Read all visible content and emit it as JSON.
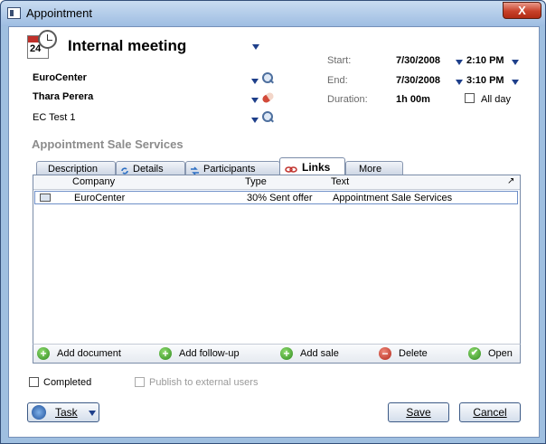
{
  "window": {
    "title": "Appointment",
    "close_glyph": "X"
  },
  "header": {
    "calendar_day": "24",
    "title": "Internal meeting",
    "company": "EuroCenter",
    "contact": "Thara Perera",
    "project": "EC Test 1"
  },
  "time": {
    "start_label": "Start:",
    "start_date": "7/30/2008",
    "start_time": "2:10 PM",
    "end_label": "End:",
    "end_date": "7/30/2008",
    "end_time": "3:10 PM",
    "duration_label": "Duration:",
    "duration_value": "1h 00m",
    "allday_label": "All day"
  },
  "section": {
    "title": "Appointment Sale Services"
  },
  "tabs": [
    {
      "label": "Description",
      "icon": "none",
      "active": false
    },
    {
      "label": "Details",
      "icon": "refresh-icon",
      "active": false
    },
    {
      "label": "Participants",
      "icon": "participants-icon",
      "active": false
    },
    {
      "label": "Links",
      "icon": "link-icon",
      "active": true
    },
    {
      "label": "More",
      "icon": "none",
      "active": false
    }
  ],
  "grid": {
    "columns": [
      "Company",
      "Type",
      "Text"
    ],
    "rows": [
      {
        "company": "EuroCenter",
        "type": "30% Sent offer",
        "text": "Appointment Sale Services"
      }
    ]
  },
  "actions": {
    "add_document": "Add document",
    "add_followup": "Add follow-up",
    "add_sale": "Add sale",
    "delete": "Delete",
    "open": "Open"
  },
  "options": {
    "completed": "Completed",
    "publish": "Publish to external users"
  },
  "footer": {
    "task": "Task",
    "save": "Save",
    "cancel": "Cancel"
  },
  "colors": {
    "title_bar": "#9ebde2",
    "close_button": "#c8412a",
    "accent_blue": "#1e3f8a",
    "add_green": "#2f8a1f",
    "delete_red": "#b3271a"
  }
}
